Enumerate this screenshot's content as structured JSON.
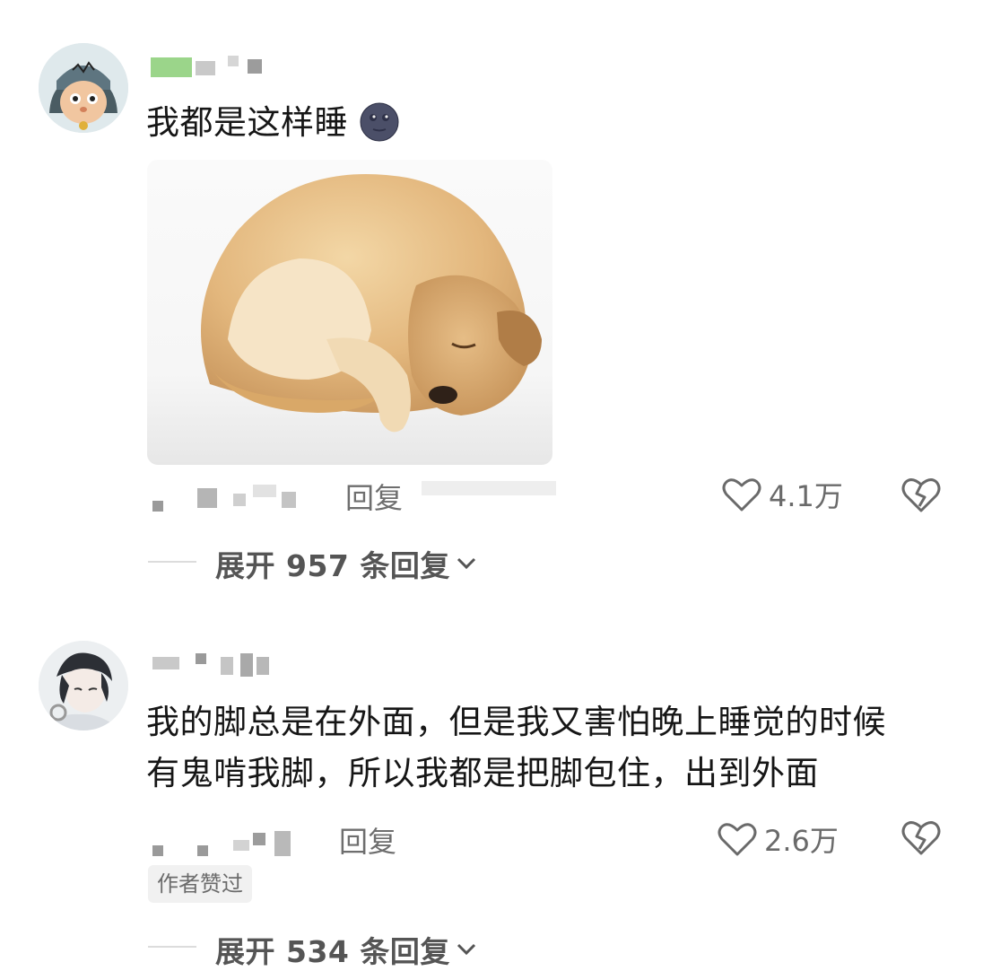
{
  "comments": [
    {
      "text": "我都是这样睡",
      "emoji_icon": "new-moon-face-icon",
      "reply_label": "回复",
      "like_count": "4.1万",
      "expand_label": "展开 957 条回复",
      "avatar_icon": "cartoon-helmet-avatar"
    },
    {
      "text_line1": "我的脚总是在外面，但是我又害怕晚上睡觉的时候",
      "text_line2": "有鬼啃我脚，所以我都是把脚包住，出到外面",
      "reply_label": "回复",
      "like_count": "2.6万",
      "author_tag": "作者赞过",
      "expand_label": "展开 534 条回复",
      "avatar_icon": "anime-character-avatar"
    }
  ],
  "image": {
    "subject": "sleeping-dog-image"
  },
  "colors": {
    "text": "#161616",
    "meta": "#6e6e6e",
    "tag_bg": "#f1f1f1"
  }
}
